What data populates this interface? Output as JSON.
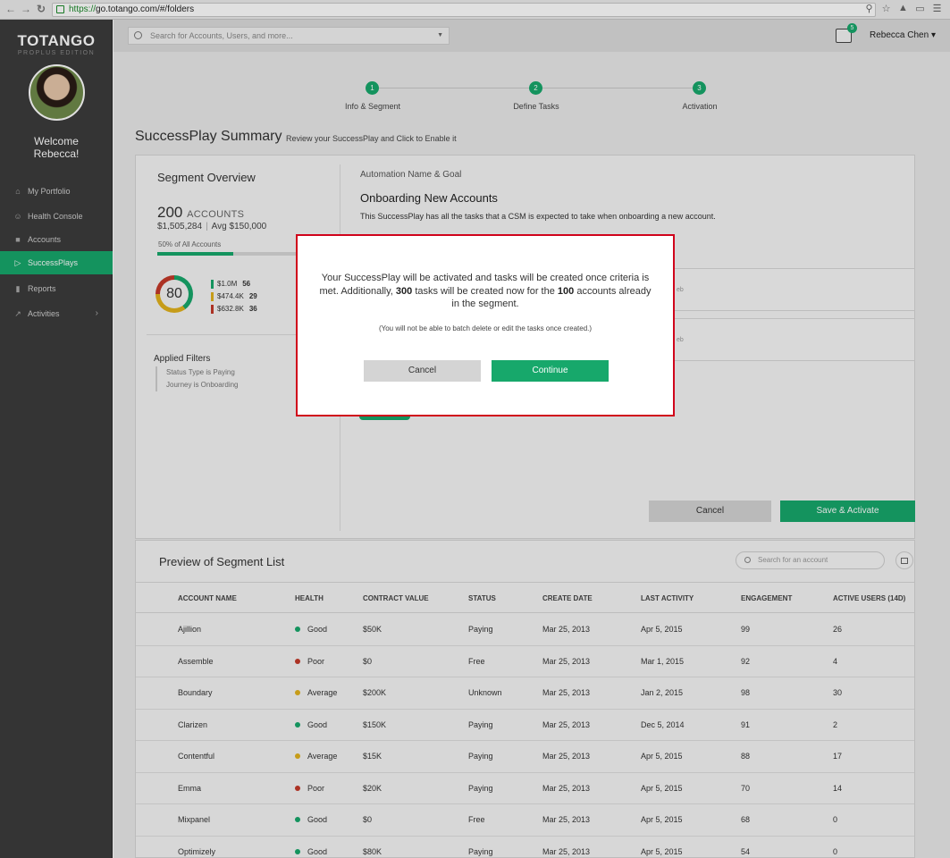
{
  "browser": {
    "url_scheme": "https://",
    "url_path": "go.totango.com/#/folders",
    "back_icon": "arrow-left-icon",
    "forward_icon": "arrow-right-icon",
    "reload_icon": "reload-icon"
  },
  "sidebar": {
    "logo": "TOTANGO",
    "edition": "PROPLUS EDITION",
    "welcome_line1": "Welcome",
    "welcome_line2": "Rebecca!",
    "items": [
      {
        "label": "My Portfolio",
        "icon": "home-icon"
      },
      {
        "label": "Health Console",
        "icon": "smiley-icon"
      },
      {
        "label": "Accounts",
        "icon": "briefcase-icon"
      },
      {
        "label": "SuccessPlays",
        "icon": "play-icon"
      },
      {
        "label": "Reports",
        "icon": "bar-chart-icon"
      },
      {
        "label": "Activities",
        "icon": "line-chart-icon"
      }
    ]
  },
  "topbar": {
    "search_placeholder": "Search for Accounts, Users, and more...",
    "inbox_count": "5",
    "user_name": "Rebecca Chen"
  },
  "steps": [
    {
      "number": "1",
      "label": "Info & Segment"
    },
    {
      "number": "2",
      "label": "Define Tasks"
    },
    {
      "number": "3",
      "label": "Activation"
    }
  ],
  "summary": {
    "title": "SuccessPlay Summary",
    "subtitle": "Review your SuccessPlay and Click to Enable it"
  },
  "segment": {
    "title": "Segment Overview",
    "count": "200",
    "count_unit": "ACCOUNTS",
    "total_value": "$1,505,284",
    "avg_label": "Avg",
    "avg_value": "$150,000",
    "share_label": "50% of All Accounts",
    "share_fraction": 0.5,
    "health_score": "80",
    "legend": [
      {
        "value": "$1.0M",
        "count": "56",
        "color": "#17a86b"
      },
      {
        "value": "$474.4K",
        "count": "29",
        "color": "#e2b21d"
      },
      {
        "value": "$632.8K",
        "count": "36",
        "color": "#c43a2a"
      }
    ],
    "filters_title": "Applied Filters",
    "filters": [
      "Status Type is Paying",
      "Journey is Onboarding"
    ]
  },
  "automation": {
    "label": "Automation Name & Goal",
    "name": "Onboarding New Accounts",
    "description": "This SuccessPlay has all the tasks that a CSM is expected to take when onboarding a new account.",
    "task_fragment": "eb"
  },
  "actions": {
    "cancel": "Cancel",
    "save_activate": "Save & Activate"
  },
  "modal": {
    "msg_part1": "Your SuccessPlay will be activated and tasks will be created once criteria is met. Additionally,",
    "tasks_count": "300",
    "msg_part2": "tasks will be created now for the",
    "accounts_count": "100",
    "msg_part3": "accounts already in the segment.",
    "note": "(You will not be able to batch delete or edit the tasks once created.)",
    "cancel": "Cancel",
    "continue": "Continue"
  },
  "preview": {
    "title": "Preview of Segment List",
    "search_placeholder": "Search for an account",
    "columns": [
      "ACCOUNT NAME",
      "HEALTH",
      "CONTRACT VALUE",
      "STATUS",
      "CREATE DATE",
      "LAST ACTIVITY",
      "ENGAGEMENT",
      "ACTIVE USERS (14D)"
    ],
    "rows": [
      {
        "name": "Ajillion",
        "health": "Good",
        "health_color": "#17a86b",
        "contract": "$50K",
        "status": "Paying",
        "created": "Mar 25, 2013",
        "last": "Apr 5, 2015",
        "engagement": "99",
        "users": "26"
      },
      {
        "name": "Assemble",
        "health": "Poor",
        "health_color": "#c43a2a",
        "contract": "$0",
        "status": "Free",
        "created": "Mar 25, 2013",
        "last": "Mar 1, 2015",
        "engagement": "92",
        "users": "4"
      },
      {
        "name": "Boundary",
        "health": "Average",
        "health_color": "#e2b21d",
        "contract": "$200K",
        "status": "Unknown",
        "created": "Mar 25, 2013",
        "last": "Jan 2, 2015",
        "engagement": "98",
        "users": "30"
      },
      {
        "name": "Clarizen",
        "health": "Good",
        "health_color": "#17a86b",
        "contract": "$150K",
        "status": "Paying",
        "created": "Mar 25, 2013",
        "last": "Dec 5, 2014",
        "engagement": "91",
        "users": "2"
      },
      {
        "name": "Contentful",
        "health": "Average",
        "health_color": "#e2b21d",
        "contract": "$15K",
        "status": "Paying",
        "created": "Mar 25, 2013",
        "last": "Apr 5, 2015",
        "engagement": "88",
        "users": "17"
      },
      {
        "name": "Emma",
        "health": "Poor",
        "health_color": "#c43a2a",
        "contract": "$20K",
        "status": "Paying",
        "created": "Mar 25, 2013",
        "last": "Apr 5, 2015",
        "engagement": "70",
        "users": "14"
      },
      {
        "name": "Mixpanel",
        "health": "Good",
        "health_color": "#17a86b",
        "contract": "$0",
        "status": "Free",
        "created": "Mar 25, 2013",
        "last": "Apr 5, 2015",
        "engagement": "68",
        "users": "0"
      },
      {
        "name": "Optimizely",
        "health": "Good",
        "health_color": "#17a86b",
        "contract": "$80K",
        "status": "Paying",
        "created": "Mar 25, 2013",
        "last": "Apr 5, 2015",
        "engagement": "54",
        "users": "0"
      }
    ]
  }
}
